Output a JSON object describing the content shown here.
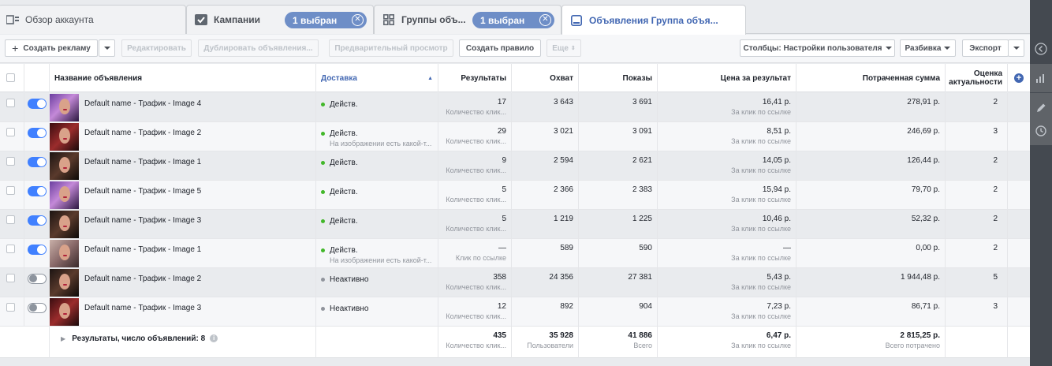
{
  "tabs": [
    {
      "label": "Обзор аккаунта",
      "icon": "account-overview-icon"
    },
    {
      "label": "Кампании",
      "icon": "campaigns-icon",
      "pill": "1 выбран"
    },
    {
      "label": "Группы объ...",
      "icon": "adsets-icon",
      "pill": "1 выбран"
    },
    {
      "label": "Объявления Группа объя...",
      "icon": "ads-icon"
    }
  ],
  "toolbar": {
    "create": "Создать рекламу",
    "edit": "Редактировать",
    "duplicate": "Дублировать объявления...",
    "preview": "Предварительный просмотр",
    "create_rule": "Создать правило",
    "more": "Еще",
    "columns": "Столбцы: Настройки пользователя",
    "breakdown": "Разбивка",
    "export": "Экспорт"
  },
  "columns": {
    "name": "Название объявления",
    "delivery": "Доставка",
    "results": "Результаты",
    "reach": "Охват",
    "impressions": "Показы",
    "cost": "Цена за результат",
    "spent": "Потраченная сумма",
    "relevance": "Оценка актуальности"
  },
  "colors": {
    "accent": "#4267b2",
    "active_dot": "#42b72a",
    "inactive_dot": "#90949c",
    "toggle_on": "#4080ff"
  },
  "rows": [
    {
      "name": "Default name - Трафик - Image 4",
      "on": true,
      "delivery": "Действ.",
      "delivery_note": "",
      "results": "17",
      "results_sub": "Количество клик...",
      "reach": "3 643",
      "impressions": "3 691",
      "cost": "16,41 р.",
      "cost_sub": "За клик по ссылке",
      "spent": "278,91 р.",
      "relevance": "2",
      "img": "purple"
    },
    {
      "name": "Default name - Трафик - Image 2",
      "on": true,
      "delivery": "Действ.",
      "delivery_note": "На изображении есть какой-т...",
      "results": "29",
      "results_sub": "Количество клик...",
      "reach": "3 021",
      "impressions": "3 091",
      "cost": "8,51 р.",
      "cost_sub": "За клик по ссылке",
      "spent": "246,69 р.",
      "relevance": "3",
      "img": "red"
    },
    {
      "name": "Default name - Трафик - Image 1",
      "on": true,
      "delivery": "Действ.",
      "delivery_note": "",
      "results": "9",
      "results_sub": "Количество клик...",
      "reach": "2 594",
      "impressions": "2 621",
      "cost": "14,05 р.",
      "cost_sub": "За клик по ссылке",
      "spent": "126,44 р.",
      "relevance": "2",
      "img": "dark"
    },
    {
      "name": "Default name - Трафик - Image 5",
      "on": true,
      "delivery": "Действ.",
      "delivery_note": "",
      "results": "5",
      "results_sub": "Количество клик...",
      "reach": "2 366",
      "impressions": "2 383",
      "cost": "15,94 р.",
      "cost_sub": "За клик по ссылке",
      "spent": "79,70 р.",
      "relevance": "2",
      "img": "purple"
    },
    {
      "name": "Default name - Трафик - Image 3",
      "on": true,
      "delivery": "Действ.",
      "delivery_note": "",
      "results": "5",
      "results_sub": "Количество клик...",
      "reach": "1 219",
      "impressions": "1 225",
      "cost": "10,46 р.",
      "cost_sub": "За клик по ссылке",
      "spent": "52,32 р.",
      "relevance": "2",
      "img": "dark"
    },
    {
      "name": "Default name - Трафик - Image 1",
      "on": true,
      "delivery": "Действ.",
      "delivery_note": "На изображении есть какой-т...",
      "results": "—",
      "results_sub": "Клик по ссылке",
      "reach": "589",
      "impressions": "590",
      "cost": "—",
      "cost_sub": "За клик по ссылке",
      "spent": "0,00 р.",
      "relevance": "2",
      "img": "light"
    },
    {
      "name": "Default name - Трафик - Image 2",
      "on": false,
      "delivery": "Неактивно",
      "delivery_note": "",
      "results": "358",
      "results_sub": "Количество клик...",
      "reach": "24 356",
      "impressions": "27 381",
      "cost": "5,43 р.",
      "cost_sub": "За клик по ссылке",
      "spent": "1 944,48 р.",
      "relevance": "5",
      "img": "dark"
    },
    {
      "name": "Default name - Трафик - Image 3",
      "on": false,
      "delivery": "Неактивно",
      "delivery_note": "",
      "results": "12",
      "results_sub": "Количество клик...",
      "reach": "892",
      "impressions": "904",
      "cost": "7,23 р.",
      "cost_sub": "За клик по ссылке",
      "spent": "86,71 р.",
      "relevance": "3",
      "img": "red"
    }
  ],
  "totals": {
    "label": "Результаты, число объявлений: 8",
    "results": "435",
    "results_sub": "Количество клик...",
    "reach": "35 928",
    "reach_sub": "Пользователи",
    "impressions": "41 886",
    "impressions_sub": "Всего",
    "cost": "6,47 р.",
    "cost_sub": "За клик по ссылке",
    "spent": "2 815,25 р.",
    "spent_sub": "Всего потрачено"
  }
}
